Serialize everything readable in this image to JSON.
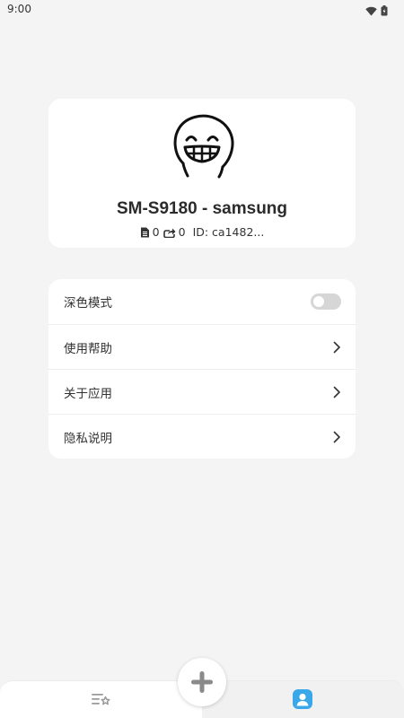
{
  "status_bar": {
    "time": "9:00",
    "icons": [
      "wifi-icon",
      "battery-icon"
    ]
  },
  "profile": {
    "device_name": "SM-S9180 - samsung",
    "file_count": "0",
    "share_count": "0",
    "id_text": "ID: ca1482..."
  },
  "settings": {
    "items": [
      {
        "label": "深色模式",
        "type": "toggle",
        "checked": false
      },
      {
        "label": "使用帮助",
        "type": "link"
      },
      {
        "label": "关于应用",
        "type": "link"
      },
      {
        "label": "隐私说明",
        "type": "link"
      }
    ]
  },
  "bottom_nav": {
    "items": [
      {
        "icon": "list-star-icon",
        "active": false
      },
      {
        "icon": "profile-icon",
        "active": true
      }
    ],
    "fab_icon": "plus-icon"
  },
  "colors": {
    "background": "#f4f4f4",
    "card": "#ffffff",
    "accent": "#3aa7e8",
    "toggle_off": "#d6d6d6"
  }
}
